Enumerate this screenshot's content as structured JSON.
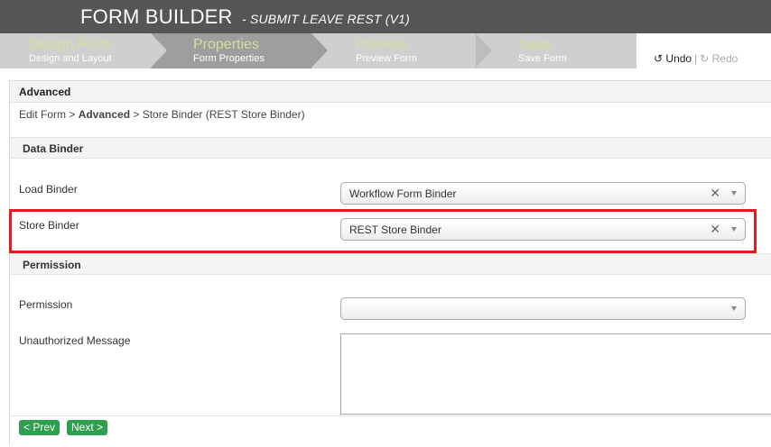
{
  "header": {
    "title": "FORM BUILDER",
    "subtitle": "- SUBMIT LEAVE REST (V1)"
  },
  "wizard": {
    "steps": [
      {
        "title": "Design Form",
        "desc": "Design and Layout",
        "active": false
      },
      {
        "title": "Properties",
        "desc": "Form Properties",
        "active": true
      },
      {
        "title": "Preview",
        "desc": "Preview Form",
        "active": false
      },
      {
        "title": "Save",
        "desc": "Save Form",
        "active": false
      }
    ],
    "undo_label": "Undo",
    "separator": "|",
    "redo_label": "Redo"
  },
  "panel": {
    "title": "Advanced",
    "breadcrumb": {
      "part1": "Edit Form > ",
      "current": "Advanced",
      "part2": " > Store Binder (REST Store Binder)"
    }
  },
  "data_binder": {
    "section_title": "Data Binder",
    "load_binder_label": "Load Binder",
    "load_binder_value": "Workflow Form Binder",
    "store_binder_label": "Store Binder",
    "store_binder_value": "REST Store Binder"
  },
  "permission": {
    "section_title": "Permission",
    "permission_label": "Permission",
    "permission_value": "",
    "unauthorized_label": "Unauthorized Message",
    "unauthorized_value": ""
  },
  "footer": {
    "prev_label": "< Prev",
    "next_label": "Next >"
  },
  "colors": {
    "topbar": "#555555",
    "active_step": "#9e9e9e",
    "steps_bg": "#cfcfcf",
    "step_title": "#d8de9a",
    "button_green": "#2e9e4f",
    "highlight_red": "#e11b22"
  }
}
